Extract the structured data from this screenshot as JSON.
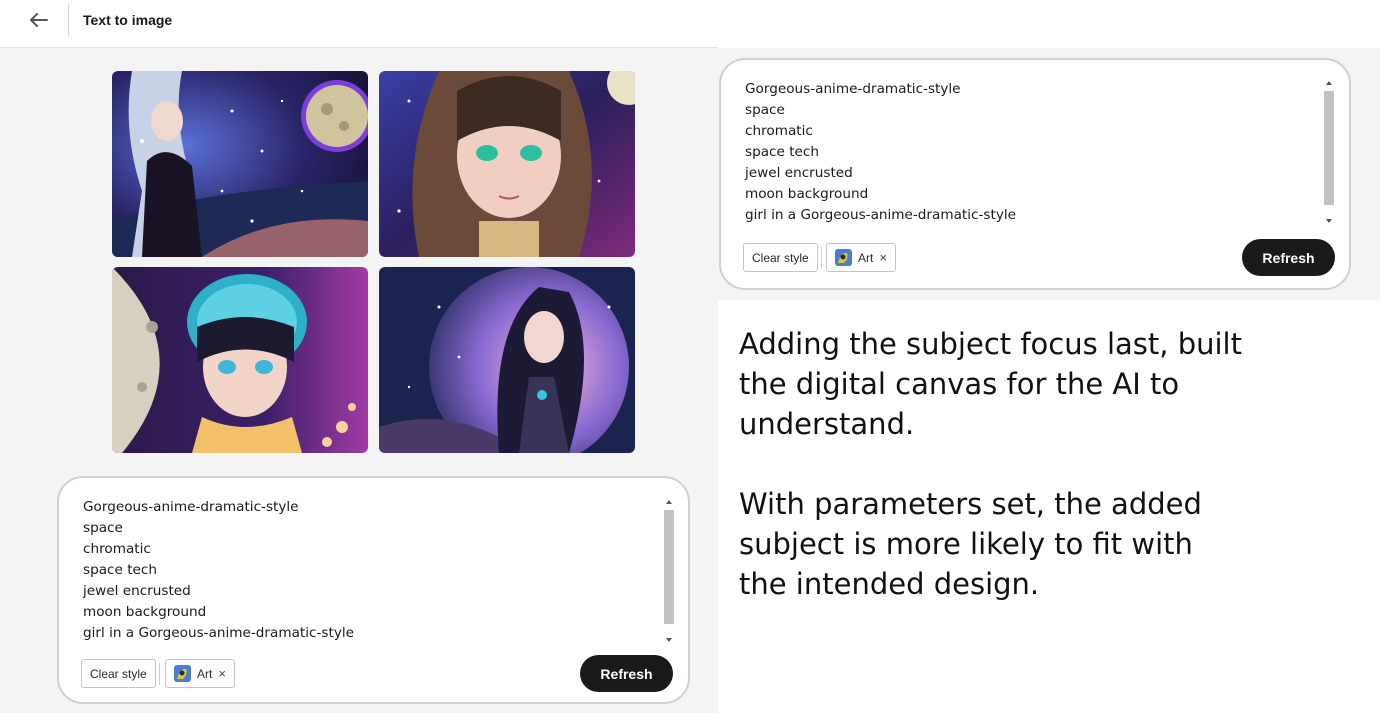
{
  "header": {
    "back_icon": "arrow-left-icon",
    "title": "Text to image"
  },
  "gallery": {
    "images": [
      {
        "name": "generated-image-1",
        "subject": "anime girl with full moon in starry space"
      },
      {
        "name": "generated-image-2",
        "subject": "anime girl portrait with jewel accents"
      },
      {
        "name": "generated-image-3",
        "subject": "anime girl with glowing helmet and crescent moon"
      },
      {
        "name": "generated-image-4",
        "subject": "anime girl in profile with large moon"
      }
    ]
  },
  "prompt_panel": {
    "lines": [
      "Gorgeous-anime-dramatic-style",
      "space",
      "chromatic",
      "space tech",
      "jewel encrusted",
      "moon background",
      "girl in a Gorgeous-anime-dramatic-style"
    ],
    "clear_style_label": "Clear style",
    "style_chip_label": "Art",
    "style_chip_remove": "×",
    "refresh_label": "Refresh"
  },
  "commentary": {
    "paragraph_1": [
      "Adding the subject focus last, built",
      "the digital canvas for the AI to",
      "understand."
    ],
    "paragraph_2": [
      "With parameters set, the added",
      "subject is more likely to fit with",
      "the intended design."
    ]
  },
  "colors": {
    "refresh_bg": "#1a1a1a",
    "workspace_bg": "#f4f4f4",
    "card_border": "#d0d0d0"
  }
}
